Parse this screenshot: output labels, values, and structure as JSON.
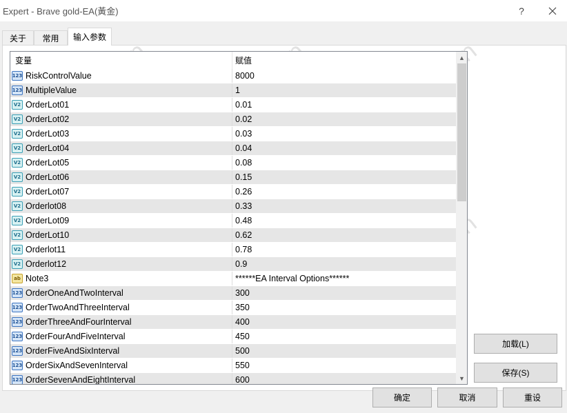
{
  "window": {
    "title": "Expert - Brave gold-EA(黃金)",
    "help_label": "?"
  },
  "tabs": [
    {
      "label": "关于"
    },
    {
      "label": "常用"
    },
    {
      "label": "输入参数"
    }
  ],
  "active_tab": "输入参数",
  "grid": {
    "columns": [
      "变量",
      "赋值"
    ],
    "rows": [
      {
        "type": "int",
        "icon": "123",
        "name": "RiskControlValue",
        "value": "8000"
      },
      {
        "type": "int",
        "icon": "123",
        "name": "MultipleValue",
        "value": "1"
      },
      {
        "type": "double",
        "icon": "V2",
        "name": "OrderLot01",
        "value": "0.01"
      },
      {
        "type": "double",
        "icon": "V2",
        "name": "OrderLot02",
        "value": "0.02"
      },
      {
        "type": "double",
        "icon": "V2",
        "name": "OrderLot03",
        "value": "0.03"
      },
      {
        "type": "double",
        "icon": "V2",
        "name": "OrderLot04",
        "value": "0.04"
      },
      {
        "type": "double",
        "icon": "V2",
        "name": "OrderLot05",
        "value": "0.08"
      },
      {
        "type": "double",
        "icon": "V2",
        "name": "OrderLot06",
        "value": "0.15"
      },
      {
        "type": "double",
        "icon": "V2",
        "name": "OrderLot07",
        "value": "0.26"
      },
      {
        "type": "double",
        "icon": "V2",
        "name": "Orderlot08",
        "value": "0.33"
      },
      {
        "type": "double",
        "icon": "V2",
        "name": "OrderLot09",
        "value": "0.48"
      },
      {
        "type": "double",
        "icon": "V2",
        "name": "OrderLot10",
        "value": "0.62"
      },
      {
        "type": "double",
        "icon": "V2",
        "name": "Orderlot11",
        "value": "0.78"
      },
      {
        "type": "double",
        "icon": "V2",
        "name": "Orderlot12",
        "value": "0.9"
      },
      {
        "type": "string",
        "icon": "ab",
        "name": "Note3",
        "value": "******EA Interval Options******"
      },
      {
        "type": "int",
        "icon": "123",
        "name": "OrderOneAndTwoInterval",
        "value": "300"
      },
      {
        "type": "int",
        "icon": "123",
        "name": "OrderTwoAndThreeInterval",
        "value": "350"
      },
      {
        "type": "int",
        "icon": "123",
        "name": "OrderThreeAndFourInterval",
        "value": "400"
      },
      {
        "type": "int",
        "icon": "123",
        "name": "OrderFourAndFiveInterval",
        "value": "450"
      },
      {
        "type": "int",
        "icon": "123",
        "name": "OrderFiveAndSixInterval",
        "value": "500"
      },
      {
        "type": "int",
        "icon": "123",
        "name": "OrderSixAndSevenInterval",
        "value": "550"
      },
      {
        "type": "int",
        "icon": "123",
        "name": "OrderSevenAndEightInterval",
        "value": "600"
      }
    ]
  },
  "buttons": {
    "load": "加载(L)",
    "save": "保存(S)",
    "ok": "确定",
    "cancel": "取消",
    "reset": "重设"
  },
  "watermark": "EAHub.cn",
  "colors": {
    "row_alt": "#e6e6e6",
    "button_bg": "#e1e1e1"
  }
}
